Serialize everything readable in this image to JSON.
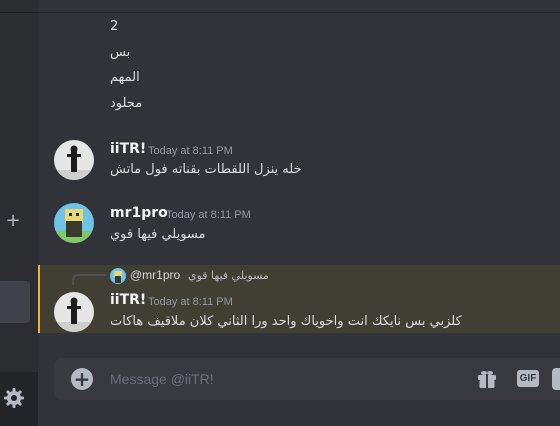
{
  "messages_above": [
    "2",
    "بس",
    "المهم",
    "مجلود"
  ],
  "messages": [
    {
      "author": "iiTR!",
      "timestamp": "Today at 8:11 PM",
      "text": "خله ينزل اللقطات بقناته فول ماتش"
    },
    {
      "author": "mr1pro",
      "timestamp": "Today at 8:11 PM",
      "text": "مسويلي فيها قوي"
    },
    {
      "author": "iiTR!",
      "timestamp": "Today at 8:11 PM",
      "text": "كلزبي بس نايكك انت واخوياك واحد ورا الثاني كلان ملاقيف هاكات"
    }
  ],
  "reply": {
    "author": "@mr1pro",
    "text": "مسويلي فيها قوي"
  },
  "composer": {
    "placeholder": "Message @iiTR!",
    "gif_label": "GIF"
  },
  "sidebar": {
    "add_label": "+"
  },
  "icons": [
    "plus-icon",
    "gear-icon",
    "gift-icon",
    "sticker-icon"
  ],
  "colors": {
    "accent_mention": "#f0b232",
    "background": "#313338"
  }
}
